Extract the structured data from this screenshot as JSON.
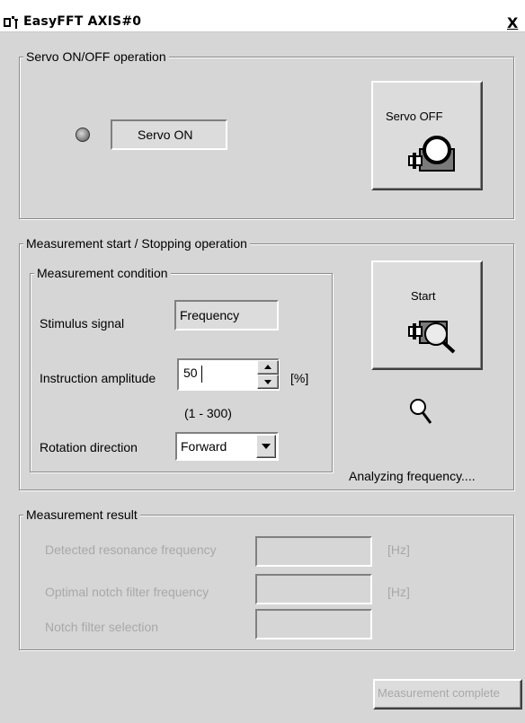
{
  "window": {
    "title": "EasyFFT AXIS#0",
    "close_label": "X"
  },
  "servo": {
    "group_label": "Servo ON/OFF operation",
    "status_text": "Servo ON",
    "button_label": "Servo OFF"
  },
  "measurement": {
    "group_label": "Measurement start / Stopping operation",
    "condition_group_label": "Measurement condition",
    "stimulus_label": "Stimulus signal",
    "stimulus_value": "Frequency",
    "amplitude_label": "Instruction amplitude",
    "amplitude_value": "50",
    "amplitude_unit": "[%]",
    "amplitude_range": "(1 - 300)",
    "direction_label": "Rotation direction",
    "direction_value": "Forward",
    "start_label": "Start",
    "status_text": "Analyzing frequency...."
  },
  "result": {
    "group_label": "Measurement result",
    "resonance_label": "Detected resonance frequency",
    "resonance_unit": "[Hz]",
    "notch_freq_label": "Optimal notch filter frequency",
    "notch_freq_unit": "[Hz]",
    "notch_sel_label": "Notch filter selection"
  },
  "footer": {
    "complete_label": "Measurement complete"
  },
  "icons": {
    "app": "app-icon",
    "servo": "servo-motor-icon",
    "start": "motor-magnifier-icon",
    "analyzing": "magnifier-icon",
    "led": "led-indicator-icon",
    "spin": "spin-arrows-icon",
    "dropdown": "chevron-down-icon"
  }
}
